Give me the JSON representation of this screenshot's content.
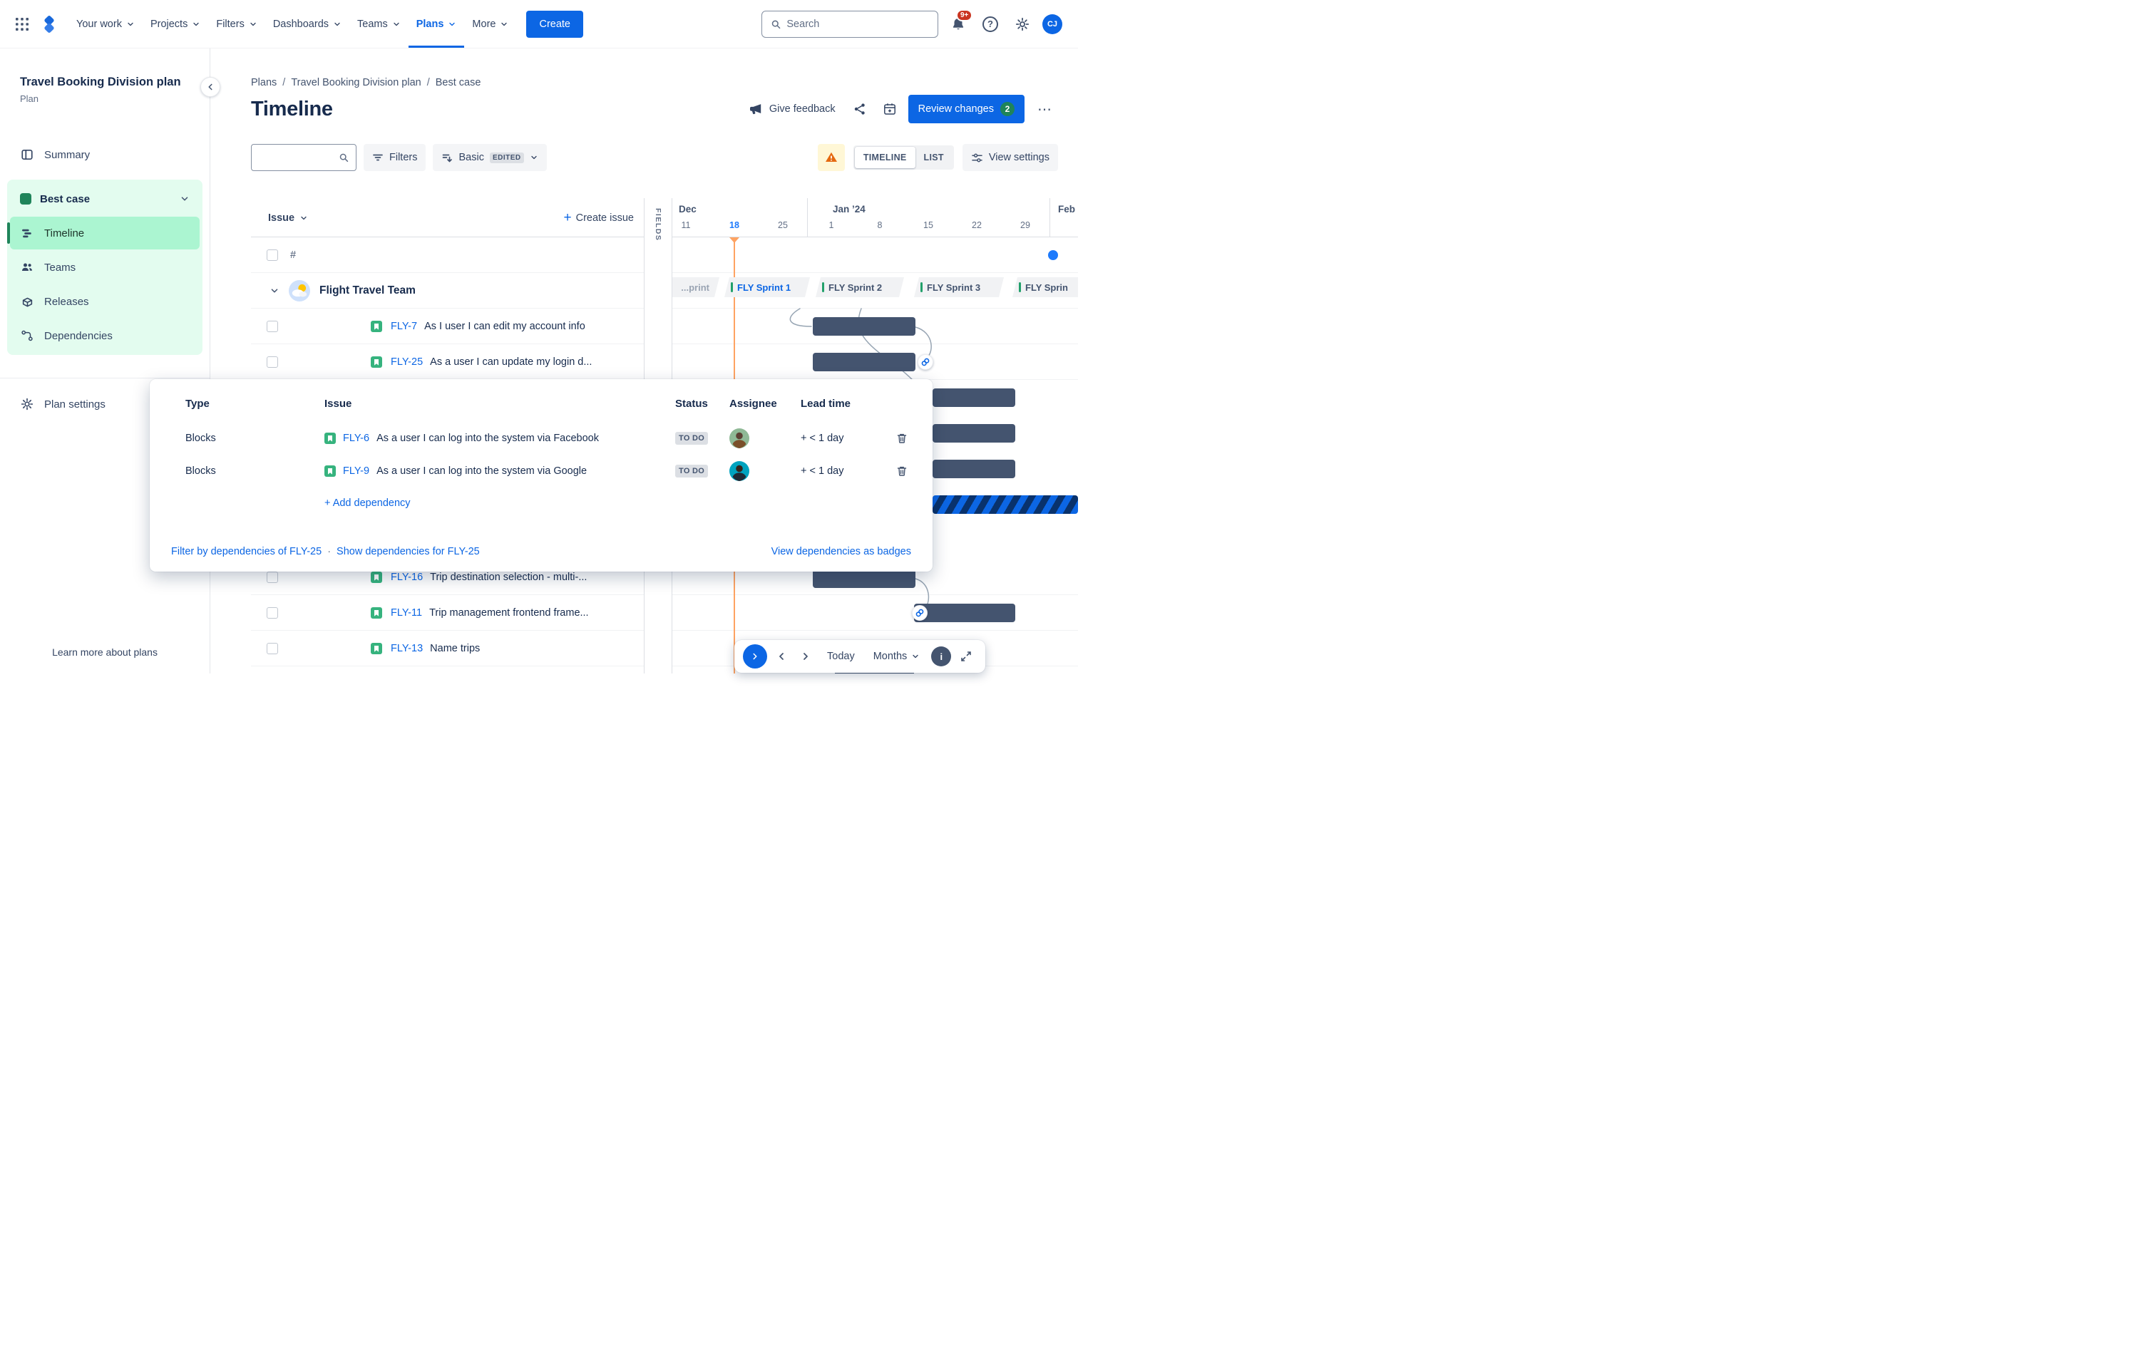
{
  "colors": {
    "primary_blue": "#0C66E4",
    "today_orange": "#FEA362",
    "bar_slate": "#44546F",
    "scenario_green": "#1F845A",
    "selected_mint": "#ABF5D1",
    "mint_bg": "#E3FCEF",
    "warning_orange": "#E56910",
    "notification_red": "#CA3521",
    "review_badge_green": "#1F845A",
    "status_lozenge_bg": "#DCDFE4"
  },
  "icons": {
    "plus": "+",
    "more": "⋯",
    "slash": "/",
    "dot": "·",
    "help": "?",
    "info": "i"
  },
  "topnav": {
    "items": [
      "Your work",
      "Projects",
      "Filters",
      "Dashboards",
      "Teams",
      "Plans",
      "More"
    ],
    "active_item": "Plans",
    "create": "Create",
    "search_placeholder": "Search",
    "notifications": "9+",
    "avatar": "CJ"
  },
  "sidebar": {
    "title": "Travel Booking Division plan",
    "subtitle": "Plan",
    "summary": "Summary",
    "scenario": "Best case",
    "items": [
      "Timeline",
      "Teams",
      "Releases",
      "Dependencies"
    ],
    "selected_item": "Timeline",
    "plan_settings": "Plan settings",
    "learn_more": "Learn more about plans"
  },
  "header": {
    "breadcrumb": [
      "Plans",
      "Travel Booking Division plan",
      "Best case"
    ],
    "title": "Timeline",
    "give_feedback": "Give feedback",
    "review_changes": "Review changes",
    "review_count": "2"
  },
  "toolbar": {
    "filters": "Filters",
    "view_mode": "Basic",
    "view_mode_tag": "EDITED",
    "toggle": [
      "TIMELINE",
      "LIST"
    ],
    "view_settings": "View settings"
  },
  "board": {
    "issue_header": "Issue",
    "create_issue": "Create issue",
    "fields": "FIELDS",
    "hash": "#",
    "team": "Flight Travel Team",
    "months": [
      "Dec",
      "Jan ’24",
      "Feb"
    ],
    "ticks": [
      "11",
      "18",
      "25",
      "1",
      "8",
      "15",
      "22",
      "29"
    ],
    "today_date": "18",
    "sprints": [
      "...print",
      "FLY Sprint 1",
      "FLY Sprint 2",
      "FLY Sprint 3",
      "FLY Sprin"
    ],
    "issues": [
      {
        "key": "FLY-7",
        "summary": "As I user I can edit my account info"
      },
      {
        "key": "FLY-25",
        "summary": "As a user I can update my login d..."
      }
    ],
    "issues_lower": [
      {
        "key": "FLY-16",
        "summary": "Trip destination selection - multi-..."
      },
      {
        "key": "FLY-11",
        "summary": "Trip management frontend frame..."
      },
      {
        "key": "FLY-13",
        "summary": "Name trips"
      }
    ]
  },
  "popup": {
    "columns": [
      "Type",
      "Issue",
      "Status",
      "Assignee",
      "Lead time"
    ],
    "rows": [
      {
        "type": "Blocks",
        "key": "FLY-6",
        "summary": "As a user I can log into the system via Facebook",
        "status": "TO DO",
        "lead_time": "+ < 1 day"
      },
      {
        "type": "Blocks",
        "key": "FLY-9",
        "summary": "As a user I can log into the system via Google",
        "status": "TO DO",
        "lead_time": "+ < 1 day"
      }
    ],
    "add_dependency": "+ Add dependency",
    "filter_link": "Filter by dependencies of FLY-25",
    "show_link": "Show dependencies for FLY-25",
    "badges_link": "View dependencies as badges"
  },
  "controls": {
    "today": "Today",
    "zoom": "Months"
  }
}
